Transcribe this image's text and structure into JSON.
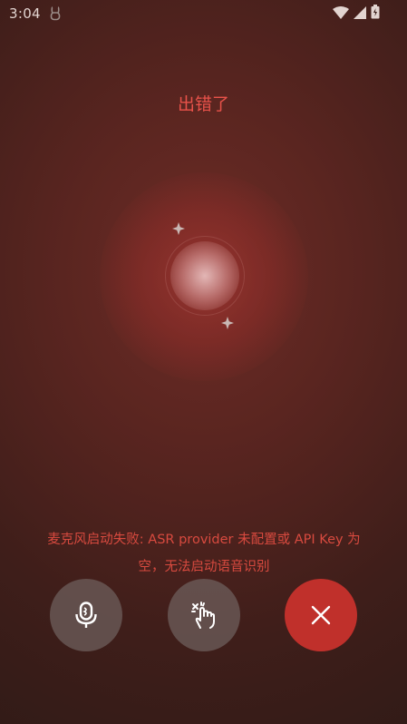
{
  "status_bar": {
    "time": "3:04",
    "app_icon": "bunny-notification-icon",
    "icons": [
      "wifi-icon",
      "cellular-signal-icon",
      "battery-icon"
    ]
  },
  "title": "出错了",
  "error_message": {
    "line1": "麦克风启动失败: ASR provider 未配置或 API Key 为",
    "line2": "空，无法启动语音识别"
  },
  "controls": {
    "mic_icon": "microphone-icon",
    "gesture_icon": "tap-gesture-icon",
    "close_icon": "close-icon"
  },
  "colors": {
    "title": "#e8524a",
    "error_text": "#d84a3f",
    "close_button": "#c0302b",
    "secondary_button": "#6e5f5c"
  }
}
